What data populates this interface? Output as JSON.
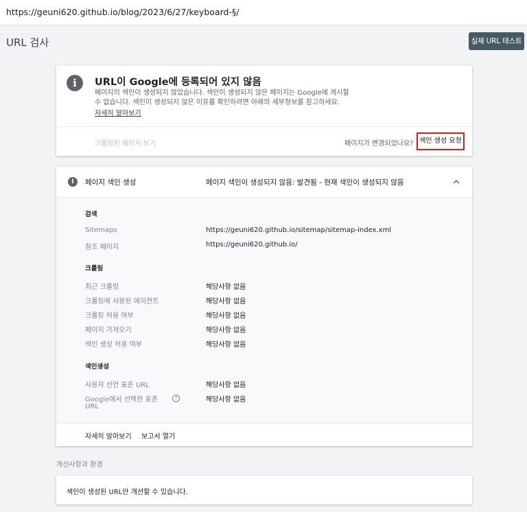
{
  "address_bar": {
    "url": "https://geuni620.github.io/blog/2023/6/27/keyboard-§/"
  },
  "header": {
    "title": "URL 검사",
    "live_test_label": "실제 URL 테스트"
  },
  "status_card": {
    "title": "URL이 Google에 등록되어 있지 않음",
    "description": "페이지의 색인이 생성되지 않았습니다. 색인이 생성되지 않은 페이지는 Google에 게시할 수 없습니다. 색인이 생성되지 않은 이유를 확인하려면 아래의 세부정보를 참고하세요.",
    "learn_more": "자세히 알아보기",
    "view_crawled": "크롤링된 페이지 보기",
    "changed_question": "페이지가 변경되었나요?",
    "request_indexing": "색인 생성 요청",
    "icon": "info-icon"
  },
  "indexing_card": {
    "title": "페이지 색인 생성",
    "status": "페이지 색인이 생성되지 않음: 발견됨 - 현재 색인이 생성되지 않음",
    "icon": "info-icon",
    "groups": {
      "discovery": {
        "title": "검색",
        "rows": [
          {
            "label": "Sitemaps",
            "value": "https://geuni620.github.io/sitemap/sitemap-index.xml"
          },
          {
            "label": "참조 페이지",
            "value": "https://geuni620.github.io/"
          }
        ]
      },
      "crawl": {
        "title": "크롤링",
        "rows": [
          {
            "label": "최근 크롤링",
            "value": "해당사항 없음"
          },
          {
            "label": "크롤링에 사용된 에이전트",
            "value": "해당사항 없음"
          },
          {
            "label": "크롤링 허용 여부",
            "value": "해당사항 없음"
          },
          {
            "label": "페이지 가져오기",
            "value": "해당사항 없음"
          },
          {
            "label": "색인 생성 허용 여부",
            "value": "해당사항 없음"
          }
        ]
      },
      "indexing": {
        "title": "색인생성",
        "rows": [
          {
            "label": "사용자 선언 표준 URL",
            "value": "해당사항 없음"
          },
          {
            "label_line1": "Google에서 선택한 표준",
            "label_line2": "URL",
            "value": "해당사항 없음"
          }
        ]
      }
    },
    "footer": {
      "learn_more": "자세히 알아보기",
      "open_report": "보고서 열기"
    }
  },
  "enhancements": {
    "title": "개선사항과 환경",
    "message": "색인이 생성된 URL만 개선할 수 있습니다."
  },
  "colors": {
    "highlight_border": "#e8190b",
    "live_test_bg": "#455a64",
    "page_bg": "#f1f3f4"
  }
}
